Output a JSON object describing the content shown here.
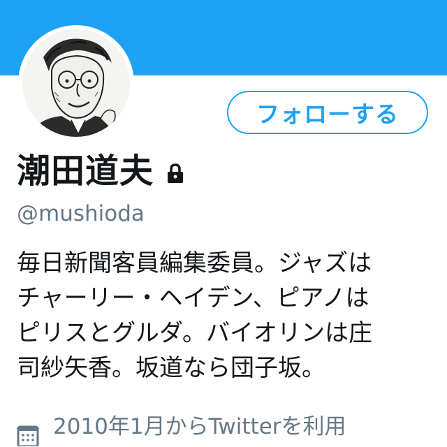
{
  "colors": {
    "accent": "#1da1f2",
    "text": "#14171a",
    "muted": "#657786",
    "background": "#ffffff"
  },
  "profile": {
    "display_name": "潮田道夫",
    "handle": "@mushioda",
    "protected_icon": "lock-icon",
    "bio_lines": [
      "毎日新聞客員編集委員。ジャズは",
      "チャーリー・ヘイデン、ピアノは",
      "ピリスとグルダ。バイオリンは庄",
      "司紗矢香。坂道なら団子坂。"
    ],
    "joined_icon": "calendar-icon",
    "joined_text": "2010年1月からTwitterを利用"
  },
  "actions": {
    "follow_label": "フォローする"
  },
  "avatar": {
    "icon": "caricature-avatar"
  }
}
